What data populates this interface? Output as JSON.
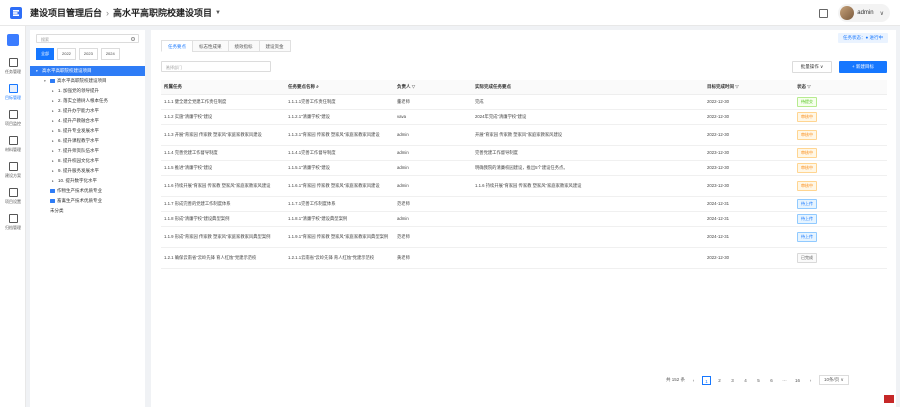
{
  "header": {
    "brand": "建设项目管理后台",
    "separator": "›",
    "project": "高水平高职院校建设项目",
    "user": "admin"
  },
  "rail": [
    {
      "label": "任务管理"
    },
    {
      "label": "目标管理"
    },
    {
      "label": "项目监控"
    },
    {
      "label": "材料管理"
    },
    {
      "label": "建设方案"
    },
    {
      "label": "项目设置"
    },
    {
      "label": "归档管理"
    }
  ],
  "tree": {
    "search_placeholder": "搜索",
    "years": [
      "全部",
      "2022",
      "2023",
      "2024"
    ],
    "nodes": [
      {
        "label": "高水平高职院校建设项目",
        "level": 0,
        "arrow": "▾",
        "selected": true,
        "folder": false
      },
      {
        "label": "高水平高职院校建设项目",
        "level": 1,
        "arrow": "▾",
        "selected": false,
        "folder": true
      },
      {
        "label": "1. 加强党的领导提升",
        "level": 2,
        "arrow": "▸",
        "selected": false,
        "folder": false
      },
      {
        "label": "2. 落实立德树人根本任务",
        "level": 2,
        "arrow": "▸",
        "selected": false,
        "folder": false
      },
      {
        "label": "3. 提升办学能力水平",
        "level": 2,
        "arrow": "▸",
        "selected": false,
        "folder": false
      },
      {
        "label": "4. 提升产教融合水平",
        "level": 2,
        "arrow": "▸",
        "selected": false,
        "folder": false
      },
      {
        "label": "5. 提升专业发展水平",
        "level": 2,
        "arrow": "▸",
        "selected": false,
        "folder": false
      },
      {
        "label": "6. 提升课程教学水平",
        "level": 2,
        "arrow": "▸",
        "selected": false,
        "folder": false
      },
      {
        "label": "7. 提升师资队伍水平",
        "level": 2,
        "arrow": "▸",
        "selected": false,
        "folder": false
      },
      {
        "label": "8. 提升校园文化水平",
        "level": 2,
        "arrow": "▸",
        "selected": false,
        "folder": false
      },
      {
        "label": "9. 提升服务发展水平",
        "level": 2,
        "arrow": "▸",
        "selected": false,
        "folder": false
      },
      {
        "label": "10. 提升数字化水平",
        "level": 2,
        "arrow": "▸",
        "selected": false,
        "folder": false
      },
      {
        "label": "作物生产技术优质专业",
        "level": 1,
        "arrow": "",
        "selected": false,
        "folder": true
      },
      {
        "label": "畜禽生产技术优质专业",
        "level": 1,
        "arrow": "",
        "selected": false,
        "folder": true
      },
      {
        "label": "未分类",
        "level": 1,
        "arrow": "",
        "selected": false,
        "folder": false
      }
    ]
  },
  "main": {
    "tabs": [
      "任务要点",
      "标志性成果",
      "绩效指标",
      "建设资金"
    ],
    "status_pill": "任务状态：● 进行中",
    "dept_placeholder": "选择部门",
    "batch_label": "批量操作 ∨",
    "new_label": "+ 新建目标",
    "columns": [
      "所属任务",
      "任务要点名称 ⌕",
      "负责人 ▽",
      "实际完成任务要点",
      "目标完成时间 ▽",
      "状态 ▽"
    ],
    "rows": [
      {
        "task": "1.1.1 健全建全党建工作责任制度",
        "point": "1.1.1.1完善工作责任制度",
        "owner": "董老师",
        "actual": "完成",
        "due": "2022-12-30",
        "status": "待提交",
        "cls": "b-done",
        "h": "r1"
      },
      {
        "task": "1.1.2 实施\"清廉学校\"建设",
        "point": "1.1.2.1\"清廉学校\"建设",
        "owner": "vava",
        "actual": "2024年完成\"清廉学校\"建设",
        "due": "2022-12-30",
        "status": "审核中",
        "cls": "b-audit",
        "h": "r1"
      },
      {
        "task": "1.1.3 开展\"育家园 传家教 塑家风\"家庭家教家风建设",
        "point": "1.1.3.1\"育家园 传家教 塑家风\"家庭家教家风建设",
        "owner": "admin",
        "actual": "开展\"育家园 传家教 塑家风\"家庭家教家风建设",
        "due": "2022-12-30",
        "status": "审核中",
        "cls": "b-audit",
        "h": "r2"
      },
      {
        "task": "1.1.4 完善党建工作督导制度",
        "point": "1.1.4.1完善工作督导制度",
        "owner": "admin",
        "actual": "完善党建工作督导制度",
        "due": "2023-12-30",
        "status": "审核中",
        "cls": "b-audit",
        "h": "r1"
      },
      {
        "task": "1.1.5 推进\"清廉学校\"建设",
        "point": "1.1.5.1\"清廉学校\"建设",
        "owner": "admin",
        "actual": "明确我院的清廉校园建设，推出5个建设任务点。",
        "due": "2023-12-30",
        "status": "审核中",
        "cls": "b-audit",
        "h": "r1"
      },
      {
        "task": "1.1.6 持续开展\"育家园 传家教 塑家风\"家庭家教家风建设",
        "point": "1.1.6.1\"育家园 传家教 塑家风\"家庭家教家风建设",
        "owner": "admin",
        "actual": "1.1.6 持续开展\"育家园 传家教 塑家风\"家庭家教家风建设",
        "due": "2023-12-30",
        "status": "审核中",
        "cls": "b-audit",
        "h": "r2"
      },
      {
        "task": "1.1.7 形成完善的党建工作制度体系",
        "point": "1.1.7.1完善工作制度体系",
        "owner": "范老师",
        "actual": "",
        "due": "2024-12-31",
        "status": "待上传",
        "cls": "b-up",
        "h": "r1"
      },
      {
        "task": "1.1.8 形成\"清廉学校\"建设典型案例",
        "point": "1.1.8.1\"清廉学校\"建设典型案例",
        "owner": "admin",
        "actual": "",
        "due": "2024-12-31",
        "status": "待上传",
        "cls": "b-up",
        "h": "r1"
      },
      {
        "task": "1.1.9 形成\"育家园 传家教 塑家风\"家庭家教家风典型案例",
        "point": "1.1.9.1\"育家园 传家教 塑家风\"家庭家教家风典型案例",
        "owner": "范老师",
        "actual": "",
        "due": "2024-12-31",
        "status": "待上传",
        "cls": "b-up",
        "h": "r2"
      },
      {
        "task": "1.2.1 确保云南省\"云岭先锋 育人红烛\"党建示范校",
        "point": "1.2.1.1云南省\"云岭先锋 育人红烛\"党建示范校",
        "owner": "黄老师",
        "actual": "",
        "due": "2022-12-30",
        "status": "已完成",
        "cls": "b-closed",
        "h": "r2"
      }
    ]
  },
  "pager": {
    "total": "共 152 条",
    "prev": "‹",
    "pages": [
      "1",
      "2",
      "3",
      "4",
      "5",
      "6",
      "···",
      "16"
    ],
    "next": "›",
    "size": "10条/页 ∨"
  }
}
